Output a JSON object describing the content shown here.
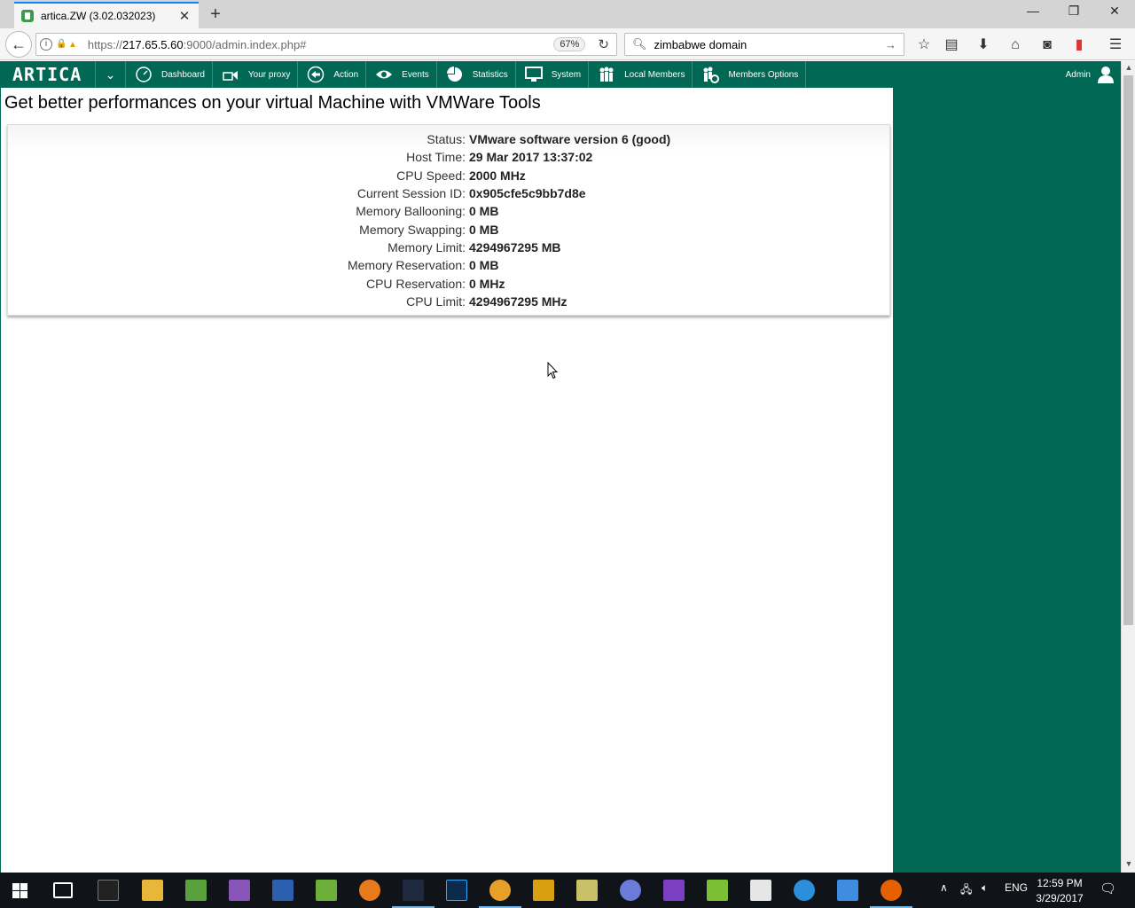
{
  "browser": {
    "tab_title": "artica.ZW (3.02.032023)",
    "url_prefix": "https://",
    "url_host": "217.65.5.60",
    "url_rest": ":9000/admin.index.php#",
    "zoom": "67%",
    "search_query": "zimbabwe domain"
  },
  "nav": {
    "logo": "ARTICA",
    "items": [
      {
        "label": "Dashboard"
      },
      {
        "label": "Your proxy"
      },
      {
        "label": "Action"
      },
      {
        "label": "Events"
      },
      {
        "label": "Statistics"
      },
      {
        "label": "System"
      },
      {
        "label": "Local Members"
      },
      {
        "label": "Members Options"
      }
    ],
    "user": "Admin"
  },
  "page": {
    "heading": "Get better performances on your virtual Machine with VMWare Tools",
    "rows": [
      {
        "label": "Status:",
        "value": "VMware software version 6 (good)"
      },
      {
        "label": "Host Time:",
        "value": "29 Mar 2017 13:37:02"
      },
      {
        "label": "CPU Speed:",
        "value": "2000 MHz"
      },
      {
        "label": "Current Session ID:",
        "value": "0x905cfe5c9bb7d8e"
      },
      {
        "label": "Memory Ballooning:",
        "value": "0 MB"
      },
      {
        "label": "Memory Swapping:",
        "value": "0 MB"
      },
      {
        "label": "Memory Limit:",
        "value": "4294967295 MB"
      },
      {
        "label": "Memory Reservation:",
        "value": "0 MB"
      },
      {
        "label": "CPU Reservation:",
        "value": "0 MHz"
      },
      {
        "label": "CPU Limit:",
        "value": "4294967295 MHz"
      }
    ]
  },
  "colors": {
    "accent": "#006854"
  },
  "taskbar": {
    "tray_lang": "ENG",
    "time": "12:59 PM",
    "date": "3/29/2017"
  }
}
